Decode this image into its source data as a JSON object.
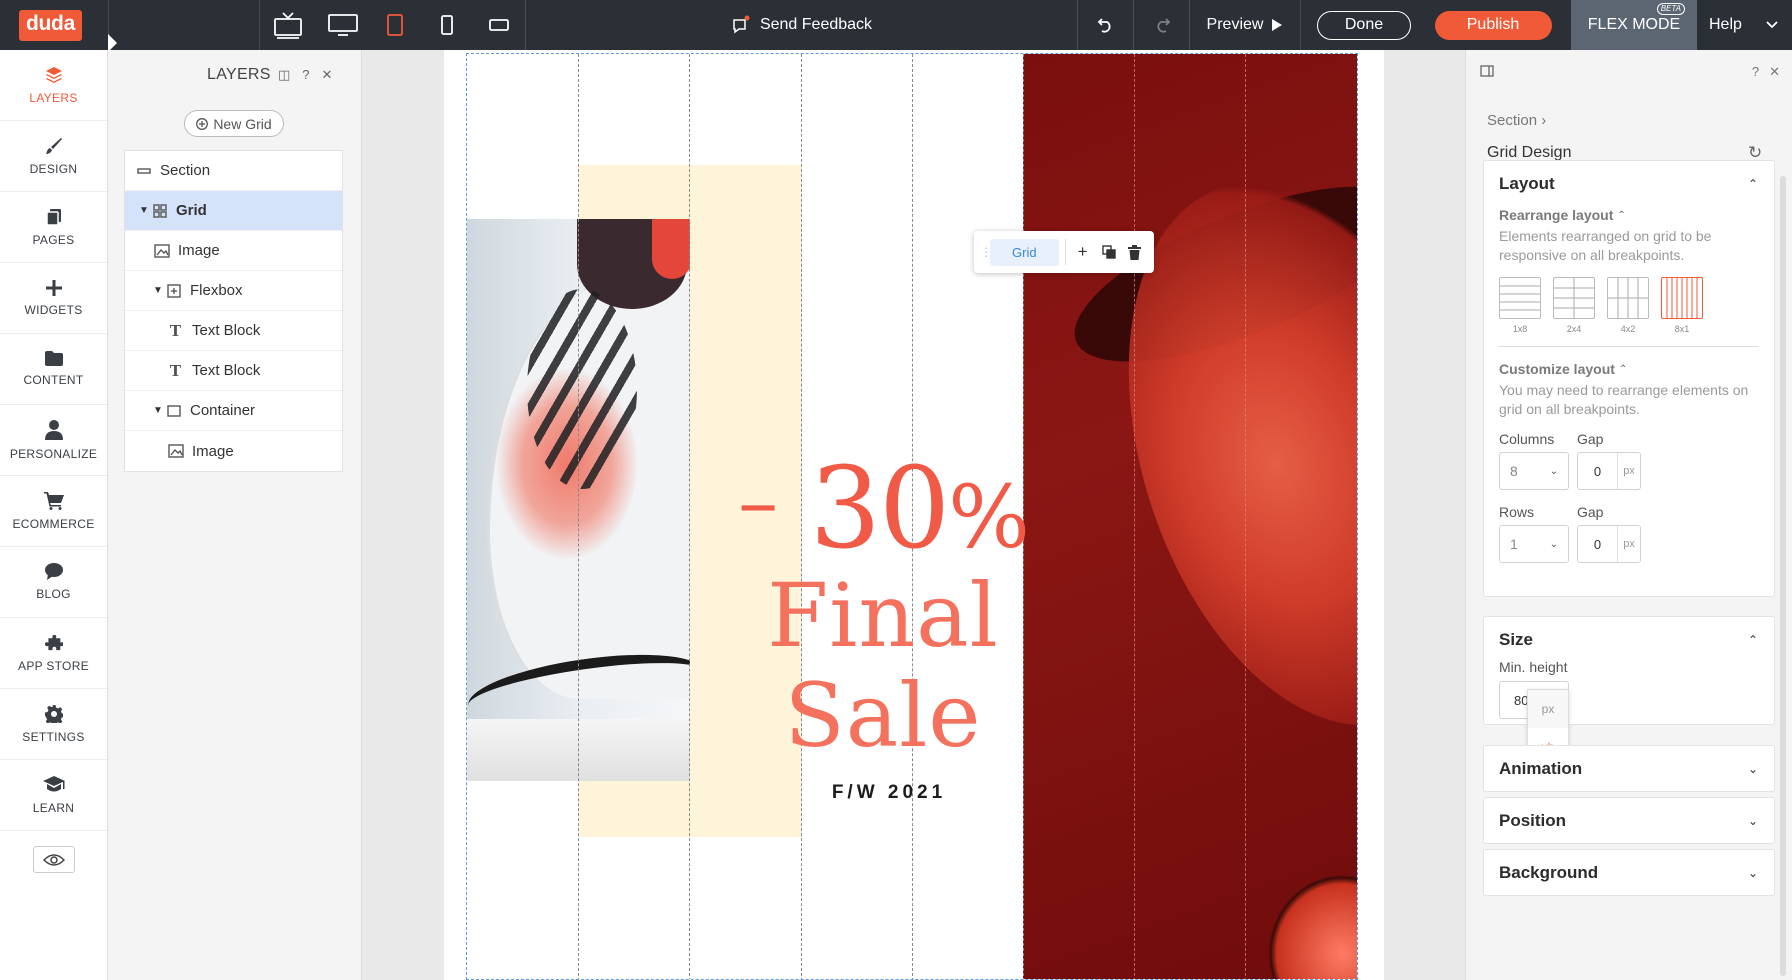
{
  "topbar": {
    "logo": "duda",
    "feedback": "Send Feedback",
    "preview": "Preview",
    "done": "Done",
    "publish": "Publish",
    "flex_mode": "FLEX MODE",
    "beta": "BETA",
    "help": "Help",
    "active_device": "tablet",
    "accent_color": "#f05a36"
  },
  "leftnav": {
    "items": [
      {
        "label": "LAYERS",
        "icon": "layers-icon"
      },
      {
        "label": "DESIGN",
        "icon": "brush-icon"
      },
      {
        "label": "PAGES",
        "icon": "pages-icon"
      },
      {
        "label": "WIDGETS",
        "icon": "plus-icon"
      },
      {
        "label": "CONTENT",
        "icon": "folder-icon"
      },
      {
        "label": "PERSONALIZE",
        "icon": "person-icon"
      },
      {
        "label": "ECOMMERCE",
        "icon": "cart-icon"
      },
      {
        "label": "BLOG",
        "icon": "chat-bubble-icon"
      },
      {
        "label": "APP STORE",
        "icon": "puzzle-icon"
      },
      {
        "label": "SETTINGS",
        "icon": "gear-icon"
      },
      {
        "label": "LEARN",
        "icon": "graduation-cap-icon"
      }
    ]
  },
  "layers": {
    "title": "LAYERS",
    "new_grid": "New Grid",
    "tree": [
      {
        "label": "Section"
      },
      {
        "label": "Grid"
      },
      {
        "label": "Image"
      },
      {
        "label": "Flexbox"
      },
      {
        "label": "Text Block"
      },
      {
        "label": "Text Block"
      },
      {
        "label": "Container"
      },
      {
        "label": "Image"
      }
    ]
  },
  "canvas": {
    "discount": "30",
    "percent_sign": "%",
    "dash": "–",
    "headline": "Final Sale",
    "season": "F/W 2021",
    "toolbar_label": "Grid"
  },
  "rpanel": {
    "breadcrumb": "Section",
    "title": "Grid Design",
    "layout": {
      "heading": "Layout",
      "rearrange_title": "Rearrange layout",
      "rearrange_text": "Elements rearranged on grid to be responsive on all breakpoints.",
      "options": [
        "1x8",
        "2x4",
        "4x2",
        "8x1"
      ],
      "active_option": "8x1",
      "customize_title": "Customize layout",
      "customize_text": "You may need to rearrange elements on grid on all breakpoints.",
      "columns_label": "Columns",
      "columns_value": "8",
      "rows_label": "Rows",
      "rows_value": "1",
      "gap_label": "Gap",
      "gap_value": "0",
      "unit": "px"
    },
    "size": {
      "heading": "Size",
      "min_height_label": "Min. height",
      "min_height_value": "80",
      "unit_options": [
        "px",
        "vh"
      ]
    },
    "animation": "Animation",
    "position": "Position",
    "background": "Background"
  }
}
